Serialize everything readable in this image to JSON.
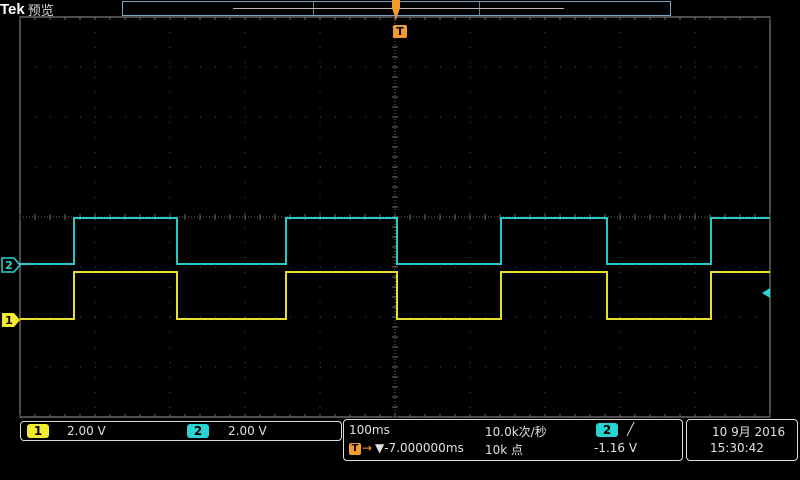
{
  "header": {
    "brand": "Tek",
    "mode": "预览"
  },
  "colors": {
    "ch1": "#f2ea2e",
    "ch2": "#2bd3d3",
    "trigger": "#f39c2b",
    "grid": "#505050",
    "border": "#9a9a9a"
  },
  "markers": {
    "ch1": "1",
    "ch2": "2",
    "trigger": "T"
  },
  "channels": [
    {
      "label": "1",
      "scale": "2.00 V",
      "color": "#f2ea2e"
    },
    {
      "label": "2",
      "scale": "2.00 V",
      "color": "#2bd3d3"
    }
  ],
  "horizontal": {
    "timebase": "100ms",
    "sample_rate": "10.0k次/秒",
    "trigger_position": "▼-7.000000ms",
    "trigger_icon": "T",
    "record_length": "10k 点"
  },
  "trigger": {
    "source": "2",
    "slope": "╱",
    "level": "-1.16 V"
  },
  "datetime": {
    "date": "10 9月 2016",
    "time": "15:30:42"
  }
}
